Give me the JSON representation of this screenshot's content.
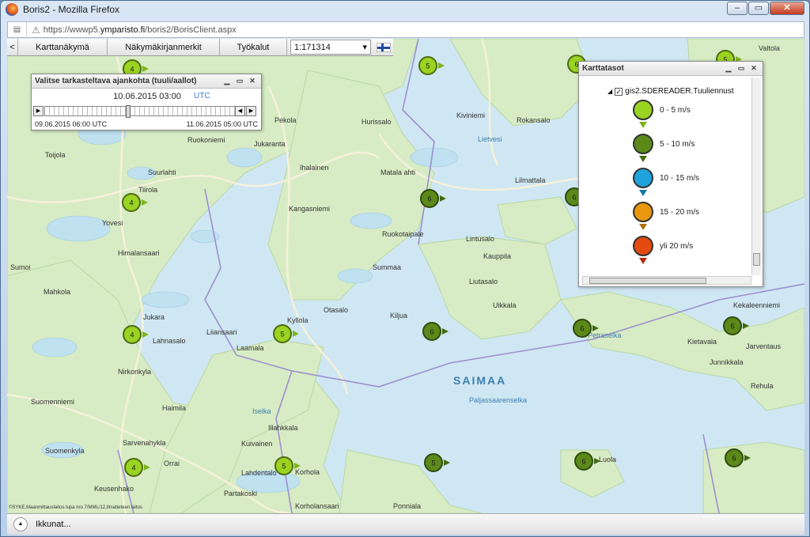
{
  "window": {
    "title": "Boris2 - Mozilla Firefox",
    "controls": [
      "–",
      "▭",
      "✕"
    ]
  },
  "url": {
    "prefix": "https://wwwp5.",
    "domain": "ymparisto.fi",
    "path": "/boris2/BorisClient.aspx"
  },
  "toolbar": {
    "back": "<",
    "items": [
      "Karttanäkymä",
      "Näkymäkirjanmerkit",
      "Työkalut"
    ],
    "scale": "1:171314"
  },
  "time_pane": {
    "title": "Valitse tarkasteltava ajankohta (tuuli/aallot)",
    "current": "10.06.2015 03:00",
    "tz": "UTC",
    "start": "09.06.2015 06:00 UTC",
    "end": "11.06.2015 05:00 UTC",
    "position": 0.4
  },
  "layers_pane": {
    "title": "Karttatasot",
    "layer": "gis2.SDEREADER.Tuuliennust",
    "legend": [
      {
        "label": "0 - 5 m/s",
        "color": "#9ad322",
        "arrow": "#7cb41a"
      },
      {
        "label": "5 - 10 m/s",
        "color": "#5c8a1a",
        "arrow": "#3f6a0f"
      },
      {
        "label": "10 - 15 m/s",
        "color": "#1ea3dc",
        "arrow": "#1478a8"
      },
      {
        "label": "15 - 20 m/s",
        "color": "#e8970f",
        "arrow": "#b46d08"
      },
      {
        "label": "yli 20 m/s",
        "color": "#e54a10",
        "arrow": "#b02c05"
      }
    ]
  },
  "map": {
    "places": [
      {
        "name": "Valtola"
      },
      {
        "name": "Hurissalo"
      },
      {
        "name": "Kiviniemi"
      },
      {
        "name": "Rokansalo"
      },
      {
        "name": "Lietvesi"
      },
      {
        "name": "Pekola"
      },
      {
        "name": "Ruokoniemi"
      },
      {
        "name": "Jukaranta"
      },
      {
        "name": "Toijola"
      },
      {
        "name": "Suurlahti"
      },
      {
        "name": "Ihalainen"
      },
      {
        "name": "Matala ahti"
      },
      {
        "name": "Tiirola"
      },
      {
        "name": "Kangasniemi"
      },
      {
        "name": "Lilmattala"
      },
      {
        "name": "Yovesi"
      },
      {
        "name": "Himalansaari"
      },
      {
        "name": "Ruokotaipale"
      },
      {
        "name": "Lintusalo"
      },
      {
        "name": "Kauppila"
      },
      {
        "name": "Sumoi"
      },
      {
        "name": "Summaa"
      },
      {
        "name": "Liutasalo"
      },
      {
        "name": "Mahkola"
      },
      {
        "name": "Uikkala"
      },
      {
        "name": "Otasalo"
      },
      {
        "name": "Kyllola"
      },
      {
        "name": "Kekaleenniemi"
      },
      {
        "name": "Jukara"
      },
      {
        "name": "Lahnasalo"
      },
      {
        "name": "Liiansaari"
      },
      {
        "name": "Kiljua"
      },
      {
        "name": "Laamala"
      },
      {
        "name": "Petraselka"
      },
      {
        "name": "Kietavala"
      },
      {
        "name": "Jarventaus"
      },
      {
        "name": "Nirkonkyla"
      },
      {
        "name": "Junnikkala"
      },
      {
        "name": "SAIMAA"
      },
      {
        "name": "Rehula"
      },
      {
        "name": "Suomenniemi"
      },
      {
        "name": "Haimila"
      },
      {
        "name": "Iselka"
      },
      {
        "name": "Paljassaarenselka"
      },
      {
        "name": "Suomenkyla"
      },
      {
        "name": "Illahkkala"
      },
      {
        "name": "Kuivainen"
      },
      {
        "name": "Sarvenahykla"
      },
      {
        "name": "Orrai"
      },
      {
        "name": "Lahdentalo"
      },
      {
        "name": "Korhola"
      },
      {
        "name": "Keusenhako"
      },
      {
        "name": "Partakoski"
      },
      {
        "name": "Ponniala"
      },
      {
        "name": "Korholansaari"
      },
      {
        "name": "Luola"
      }
    ],
    "markers": [
      {
        "value": "4",
        "level": 0
      },
      {
        "value": "5",
        "level": 0
      },
      {
        "value": "6",
        "level": 0
      },
      {
        "value": "5",
        "level": 0
      },
      {
        "value": "6",
        "level": 1
      },
      {
        "value": "4",
        "level": 0
      },
      {
        "value": "6",
        "level": 1
      },
      {
        "value": "4",
        "level": 0
      },
      {
        "value": "5",
        "level": 0
      },
      {
        "value": "6",
        "level": 1
      },
      {
        "value": "6",
        "level": 1
      },
      {
        "value": "6",
        "level": 1
      },
      {
        "value": "4",
        "level": 0
      },
      {
        "value": "5",
        "level": 0
      },
      {
        "value": "5",
        "level": 1
      },
      {
        "value": "6",
        "level": 1
      },
      {
        "value": "6",
        "level": 1
      }
    ],
    "copyright": "©SYKE,Maanmittauslaitos lupa nro 7/MML/12,Ilmatieteen laitos"
  },
  "bottom": {
    "label": "Ikkunat..."
  }
}
